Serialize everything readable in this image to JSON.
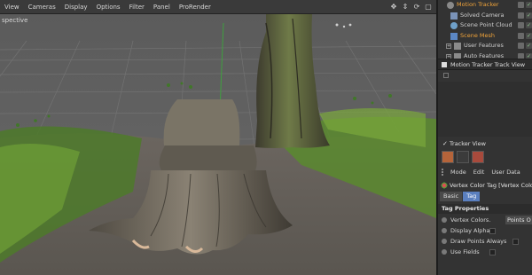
{
  "viewport": {
    "menu": [
      "View",
      "Cameras",
      "Display",
      "Options",
      "Filter",
      "Panel",
      "ProRender"
    ],
    "label": "spective",
    "nav_icons": [
      "move-view-icon",
      "zoom-view-icon",
      "rotate-view-icon",
      "maximize-view-icon"
    ]
  },
  "object_manager": {
    "items": [
      {
        "label": "Motion Tracker",
        "highlight": true,
        "expandable": false
      },
      {
        "label": "Solved Camera",
        "highlight": false,
        "expandable": false
      },
      {
        "label": "Scene Point Cloud",
        "highlight": false,
        "expandable": false
      },
      {
        "label": "Scene Mesh",
        "highlight": true,
        "expandable": false
      },
      {
        "label": "User Features",
        "highlight": false,
        "expandable": true
      },
      {
        "label": "Auto Features",
        "highlight": false,
        "expandable": true
      }
    ]
  },
  "track_view": {
    "title": "Motion Tracker Track View",
    "tracker_view_label": "Tracker View",
    "tracker_view_checked": true
  },
  "attribute_manager": {
    "menu": [
      "Mode",
      "Edit",
      "User Data"
    ],
    "tag_title": "Vertex Color Tag [Vertex Colo",
    "tabs": [
      {
        "label": "Basic",
        "active": false
      },
      {
        "label": "Tag",
        "active": true
      }
    ],
    "section_title": "Tag Properties",
    "properties": [
      {
        "label": "Vertex Colors.",
        "value": "Points O"
      },
      {
        "label": "Display Alpha.",
        "value": ""
      },
      {
        "label": "Draw Points Always",
        "value": ""
      },
      {
        "label": "Use Fields",
        "value": ""
      }
    ]
  },
  "colors": {
    "accent": "#5a7fbf",
    "highlight": "#f2a43a",
    "panel_bg": "#333333",
    "viewport_bg": "#5f5f5f"
  }
}
